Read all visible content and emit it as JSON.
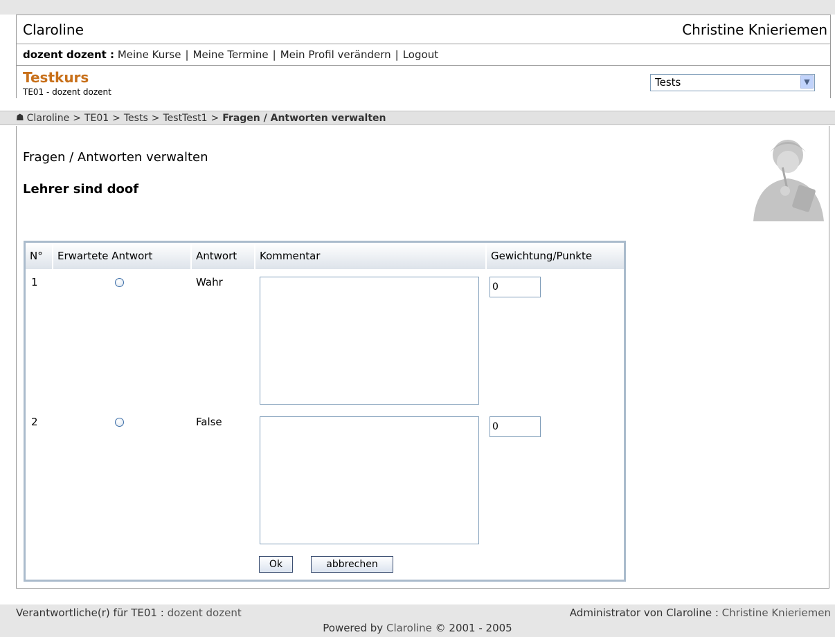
{
  "header": {
    "site_name": "Claroline",
    "admin_name": "Christine Knieriemen"
  },
  "usernav": {
    "user": "dozent dozent :",
    "links": [
      "Meine Kurse",
      "Meine Termine",
      "Mein Profil verändern",
      "Logout"
    ]
  },
  "course": {
    "name": "Testkurs",
    "subtitle": "TE01 - dozent dozent",
    "tool_select": "Tests"
  },
  "breadcrumb": {
    "items": [
      "Claroline",
      "TE01",
      "Tests",
      "TestTest1"
    ],
    "current": "Fragen / Antworten verwalten"
  },
  "main": {
    "heading": "Fragen / Antworten verwalten",
    "question": "Lehrer sind doof"
  },
  "table": {
    "headers": [
      "N°",
      "Erwartete Antwort",
      "Antwort",
      "Kommentar",
      "Gewichtung/Punkte"
    ],
    "rows": [
      {
        "no": "1",
        "answer": "Wahr",
        "comment": "",
        "points": "0"
      },
      {
        "no": "2",
        "answer": "False",
        "comment": "",
        "points": "0"
      }
    ],
    "ok_label": "Ok",
    "cancel_label": "abbrechen"
  },
  "footer": {
    "responsible_label": "Verantwortliche(r) für TE01 : ",
    "responsible_name": "dozent dozent",
    "admin_label": "Administrator von Claroline : ",
    "admin_name": "Christine Knieriemen",
    "powered_prefix": "Powered by ",
    "powered_link": "Claroline",
    "powered_suffix": " © 2001 - 2005"
  },
  "colors": {
    "course_title": "#c8701a",
    "table_border": "#aabbcc",
    "breadcrumb_bg": "#e2e2e2"
  }
}
